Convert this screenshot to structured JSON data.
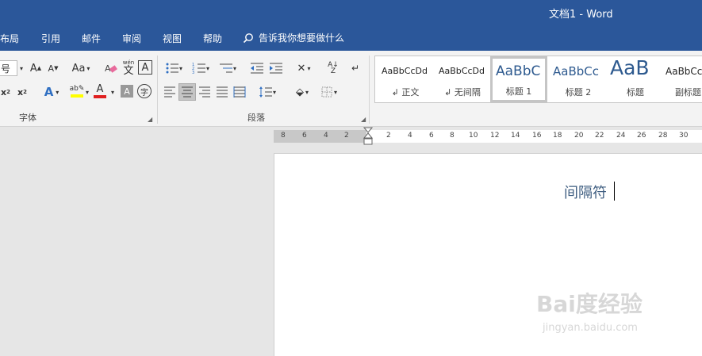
{
  "titlebar": {
    "title": "文档1  -  Word"
  },
  "menu": {
    "items": [
      "布局",
      "引用",
      "邮件",
      "审阅",
      "视图",
      "帮助"
    ],
    "tell_me": "告诉我你想要做什么"
  },
  "font_group": {
    "label": "字体",
    "size_label": "号",
    "change_case": "Aa",
    "pinyin": "wén",
    "border_char": "A",
    "enclose_char": "字"
  },
  "paragraph_group": {
    "label": "段落"
  },
  "styles": [
    {
      "sample": "AaBbCcDd",
      "name": "正文"
    },
    {
      "sample": "AaBbCcDd",
      "name": "无间隔"
    },
    {
      "sample": "AaBbC",
      "name": "标题 1"
    },
    {
      "sample": "AaBbCc",
      "name": "标题 2"
    },
    {
      "sample": "AaB",
      "name": "标题"
    },
    {
      "sample": "AaBbCc",
      "name": "副标题"
    }
  ],
  "ruler": {
    "left_ticks": [
      "8",
      "6",
      "4",
      "2"
    ],
    "right_ticks": [
      "2",
      "4",
      "6",
      "8",
      "10",
      "12",
      "14",
      "16",
      "18",
      "20",
      "22",
      "24",
      "26",
      "28",
      "30"
    ]
  },
  "document": {
    "text": "间隔符"
  },
  "watermark": {
    "brand": "Bai度经验",
    "url": "jingyan.baidu.com"
  },
  "colors": {
    "accent": "#2b579a",
    "highlight": "#ffff00",
    "font_color": "#e02020"
  }
}
